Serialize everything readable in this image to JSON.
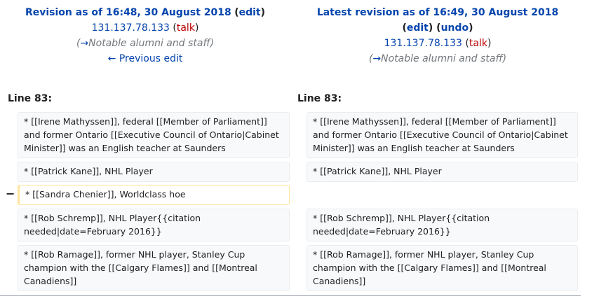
{
  "left_header": {
    "title": "Revision as of 16:48, 30 August 2018",
    "edit_link": "edit",
    "user_ip": "131.137.78.133",
    "talk_link": "talk",
    "summary_section": "Notable alumni and staff",
    "prev_edit": "← Previous edit"
  },
  "right_header": {
    "title": "Latest revision as of 16:49, 30 August 2018",
    "edit_link": "edit",
    "undo_link": "undo",
    "user_ip": "131.137.78.133",
    "talk_link": "talk",
    "summary_section": "Notable alumni and staff"
  },
  "line_label_left": "Line 83:",
  "line_label_right": "Line 83:",
  "deleted_marker": "−",
  "left_rows": [
    "* [[Irene Mathyssen]], federal [[Member of Parliament]] and former Ontario [[Executive Council of Ontario|Cabinet Minister]] was an English teacher at Saunders",
    "* [[Patrick Kane]], NHL Player",
    "* [[Sandra Chenier]], Worldclass hoe",
    "* [[Rob Schremp]], NHL Player{{citation needed|date=February 2016}}",
    "* [[Rob Ramage]], former NHL player, Stanley Cup champion with the [[Calgary Flames]] and [[Montreal Canadiens]]"
  ],
  "right_rows": [
    "* [[Irene Mathyssen]], federal [[Member of Parliament]] and former Ontario [[Executive Council of Ontario|Cabinet Minister]] was an English teacher at Saunders",
    "* [[Patrick Kane]], NHL Player",
    "* [[Rob Schremp]], NHL Player{{citation needed|date=February 2016}}",
    "* [[Rob Ramage]], former NHL player, Stanley Cup champion with the [[Calgary Flames]] and [[Montreal Canadiens]]"
  ]
}
